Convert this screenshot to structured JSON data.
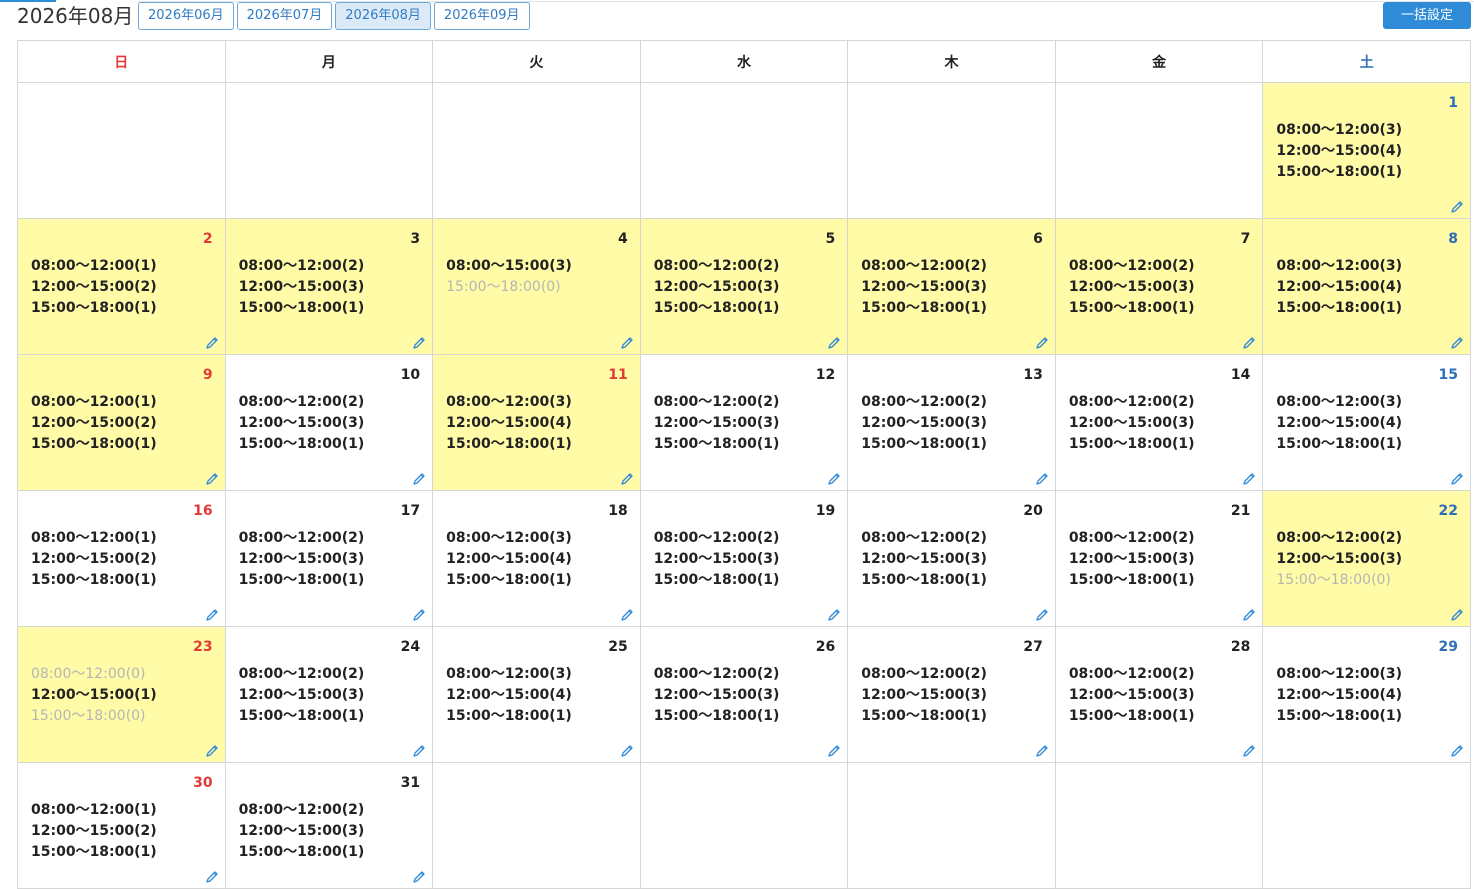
{
  "header": {
    "title": "2026年08月",
    "tabs": [
      {
        "label": "2026年06月",
        "active": false
      },
      {
        "label": "2026年07月",
        "active": false
      },
      {
        "label": "2026年08月",
        "active": true
      },
      {
        "label": "2026年09月",
        "active": false
      }
    ],
    "bulk_button": "一括設定"
  },
  "colors": {
    "highlight": "#fffba7",
    "sunday": "#e53935",
    "saturday": "#2f6fb8",
    "accent": "#2f8bd8"
  },
  "weekdays": [
    "日",
    "月",
    "火",
    "水",
    "木",
    "金",
    "土"
  ],
  "weeks": [
    [
      null,
      null,
      null,
      null,
      null,
      null,
      {
        "day": "1",
        "hl": true,
        "slots": [
          {
            "t": "08:00〜12:00(3)",
            "dim": false
          },
          {
            "t": "12:00〜15:00(4)",
            "dim": false
          },
          {
            "t": "15:00〜18:00(1)",
            "dim": false
          }
        ]
      }
    ],
    [
      {
        "day": "2",
        "hl": true,
        "slots": [
          {
            "t": "08:00〜12:00(1)",
            "dim": false
          },
          {
            "t": "12:00〜15:00(2)",
            "dim": false
          },
          {
            "t": "15:00〜18:00(1)",
            "dim": false
          }
        ]
      },
      {
        "day": "3",
        "hl": true,
        "slots": [
          {
            "t": "08:00〜12:00(2)",
            "dim": false
          },
          {
            "t": "12:00〜15:00(3)",
            "dim": false
          },
          {
            "t": "15:00〜18:00(1)",
            "dim": false
          }
        ]
      },
      {
        "day": "4",
        "hl": true,
        "slots": [
          {
            "t": "08:00〜15:00(3)",
            "dim": false
          },
          {
            "t": "15:00〜18:00(0)",
            "dim": true
          }
        ]
      },
      {
        "day": "5",
        "hl": true,
        "slots": [
          {
            "t": "08:00〜12:00(2)",
            "dim": false
          },
          {
            "t": "12:00〜15:00(3)",
            "dim": false
          },
          {
            "t": "15:00〜18:00(1)",
            "dim": false
          }
        ]
      },
      {
        "day": "6",
        "hl": true,
        "slots": [
          {
            "t": "08:00〜12:00(2)",
            "dim": false
          },
          {
            "t": "12:00〜15:00(3)",
            "dim": false
          },
          {
            "t": "15:00〜18:00(1)",
            "dim": false
          }
        ]
      },
      {
        "day": "7",
        "hl": true,
        "slots": [
          {
            "t": "08:00〜12:00(2)",
            "dim": false
          },
          {
            "t": "12:00〜15:00(3)",
            "dim": false
          },
          {
            "t": "15:00〜18:00(1)",
            "dim": false
          }
        ]
      },
      {
        "day": "8",
        "hl": true,
        "slots": [
          {
            "t": "08:00〜12:00(3)",
            "dim": false
          },
          {
            "t": "12:00〜15:00(4)",
            "dim": false
          },
          {
            "t": "15:00〜18:00(1)",
            "dim": false
          }
        ]
      }
    ],
    [
      {
        "day": "9",
        "hl": true,
        "slots": [
          {
            "t": "08:00〜12:00(1)",
            "dim": false
          },
          {
            "t": "12:00〜15:00(2)",
            "dim": false
          },
          {
            "t": "15:00〜18:00(1)",
            "dim": false
          }
        ]
      },
      {
        "day": "10",
        "hl": false,
        "slots": [
          {
            "t": "08:00〜12:00(2)",
            "dim": false
          },
          {
            "t": "12:00〜15:00(3)",
            "dim": false
          },
          {
            "t": "15:00〜18:00(1)",
            "dim": false
          }
        ]
      },
      {
        "day": "11",
        "hl": true,
        "holiday": true,
        "slots": [
          {
            "t": "08:00〜12:00(3)",
            "dim": false
          },
          {
            "t": "12:00〜15:00(4)",
            "dim": false
          },
          {
            "t": "15:00〜18:00(1)",
            "dim": false
          }
        ]
      },
      {
        "day": "12",
        "hl": false,
        "slots": [
          {
            "t": "08:00〜12:00(2)",
            "dim": false
          },
          {
            "t": "12:00〜15:00(3)",
            "dim": false
          },
          {
            "t": "15:00〜18:00(1)",
            "dim": false
          }
        ]
      },
      {
        "day": "13",
        "hl": false,
        "slots": [
          {
            "t": "08:00〜12:00(2)",
            "dim": false
          },
          {
            "t": "12:00〜15:00(3)",
            "dim": false
          },
          {
            "t": "15:00〜18:00(1)",
            "dim": false
          }
        ]
      },
      {
        "day": "14",
        "hl": false,
        "slots": [
          {
            "t": "08:00〜12:00(2)",
            "dim": false
          },
          {
            "t": "12:00〜15:00(3)",
            "dim": false
          },
          {
            "t": "15:00〜18:00(1)",
            "dim": false
          }
        ]
      },
      {
        "day": "15",
        "hl": false,
        "slots": [
          {
            "t": "08:00〜12:00(3)",
            "dim": false
          },
          {
            "t": "12:00〜15:00(4)",
            "dim": false
          },
          {
            "t": "15:00〜18:00(1)",
            "dim": false
          }
        ]
      }
    ],
    [
      {
        "day": "16",
        "hl": false,
        "slots": [
          {
            "t": "08:00〜12:00(1)",
            "dim": false
          },
          {
            "t": "12:00〜15:00(2)",
            "dim": false
          },
          {
            "t": "15:00〜18:00(1)",
            "dim": false
          }
        ]
      },
      {
        "day": "17",
        "hl": false,
        "slots": [
          {
            "t": "08:00〜12:00(2)",
            "dim": false
          },
          {
            "t": "12:00〜15:00(3)",
            "dim": false
          },
          {
            "t": "15:00〜18:00(1)",
            "dim": false
          }
        ]
      },
      {
        "day": "18",
        "hl": false,
        "slots": [
          {
            "t": "08:00〜12:00(3)",
            "dim": false
          },
          {
            "t": "12:00〜15:00(4)",
            "dim": false
          },
          {
            "t": "15:00〜18:00(1)",
            "dim": false
          }
        ]
      },
      {
        "day": "19",
        "hl": false,
        "slots": [
          {
            "t": "08:00〜12:00(2)",
            "dim": false
          },
          {
            "t": "12:00〜15:00(3)",
            "dim": false
          },
          {
            "t": "15:00〜18:00(1)",
            "dim": false
          }
        ]
      },
      {
        "day": "20",
        "hl": false,
        "slots": [
          {
            "t": "08:00〜12:00(2)",
            "dim": false
          },
          {
            "t": "12:00〜15:00(3)",
            "dim": false
          },
          {
            "t": "15:00〜18:00(1)",
            "dim": false
          }
        ]
      },
      {
        "day": "21",
        "hl": false,
        "slots": [
          {
            "t": "08:00〜12:00(2)",
            "dim": false
          },
          {
            "t": "12:00〜15:00(3)",
            "dim": false
          },
          {
            "t": "15:00〜18:00(1)",
            "dim": false
          }
        ]
      },
      {
        "day": "22",
        "hl": true,
        "slots": [
          {
            "t": "08:00〜12:00(2)",
            "dim": false
          },
          {
            "t": "12:00〜15:00(3)",
            "dim": false
          },
          {
            "t": "15:00〜18:00(0)",
            "dim": true
          }
        ]
      }
    ],
    [
      {
        "day": "23",
        "hl": true,
        "slots": [
          {
            "t": "08:00〜12:00(0)",
            "dim": true
          },
          {
            "t": "12:00〜15:00(1)",
            "dim": false
          },
          {
            "t": "15:00〜18:00(0)",
            "dim": true
          }
        ]
      },
      {
        "day": "24",
        "hl": false,
        "slots": [
          {
            "t": "08:00〜12:00(2)",
            "dim": false
          },
          {
            "t": "12:00〜15:00(3)",
            "dim": false
          },
          {
            "t": "15:00〜18:00(1)",
            "dim": false
          }
        ]
      },
      {
        "day": "25",
        "hl": false,
        "slots": [
          {
            "t": "08:00〜12:00(3)",
            "dim": false
          },
          {
            "t": "12:00〜15:00(4)",
            "dim": false
          },
          {
            "t": "15:00〜18:00(1)",
            "dim": false
          }
        ]
      },
      {
        "day": "26",
        "hl": false,
        "slots": [
          {
            "t": "08:00〜12:00(2)",
            "dim": false
          },
          {
            "t": "12:00〜15:00(3)",
            "dim": false
          },
          {
            "t": "15:00〜18:00(1)",
            "dim": false
          }
        ]
      },
      {
        "day": "27",
        "hl": false,
        "slots": [
          {
            "t": "08:00〜12:00(2)",
            "dim": false
          },
          {
            "t": "12:00〜15:00(3)",
            "dim": false
          },
          {
            "t": "15:00〜18:00(1)",
            "dim": false
          }
        ]
      },
      {
        "day": "28",
        "hl": false,
        "slots": [
          {
            "t": "08:00〜12:00(2)",
            "dim": false
          },
          {
            "t": "12:00〜15:00(3)",
            "dim": false
          },
          {
            "t": "15:00〜18:00(1)",
            "dim": false
          }
        ]
      },
      {
        "day": "29",
        "hl": false,
        "slots": [
          {
            "t": "08:00〜12:00(3)",
            "dim": false
          },
          {
            "t": "12:00〜15:00(4)",
            "dim": false
          },
          {
            "t": "15:00〜18:00(1)",
            "dim": false
          }
        ]
      }
    ],
    [
      {
        "day": "30",
        "hl": false,
        "slots": [
          {
            "t": "08:00〜12:00(1)",
            "dim": false
          },
          {
            "t": "12:00〜15:00(2)",
            "dim": false
          },
          {
            "t": "15:00〜18:00(1)",
            "dim": false
          }
        ]
      },
      {
        "day": "31",
        "hl": false,
        "slots": [
          {
            "t": "08:00〜12:00(2)",
            "dim": false
          },
          {
            "t": "12:00〜15:00(3)",
            "dim": false
          },
          {
            "t": "15:00〜18:00(1)",
            "dim": false
          }
        ]
      },
      null,
      null,
      null,
      null,
      null
    ]
  ]
}
